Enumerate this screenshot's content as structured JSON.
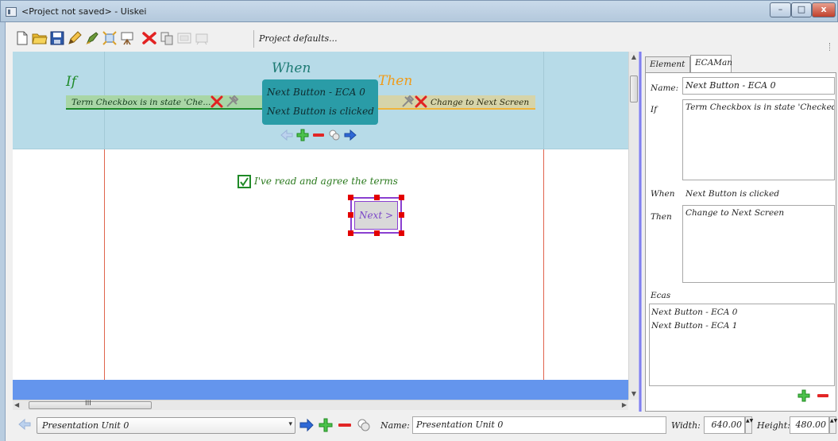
{
  "window": {
    "title": "<Project not saved> - Uiskei",
    "minimize_glyph": "–",
    "maximize_glyph": "□",
    "close_glyph": "x"
  },
  "toolbar": {
    "icons": [
      "new-file-icon",
      "open-folder-icon",
      "save-icon",
      "pencil-icon",
      "edit-brush-icon",
      "resize-icon",
      "easel-icon",
      "delete-icon",
      "copy-icon",
      "screen-capture-icon",
      "presentation-icon"
    ],
    "project_defaults_label": "Project defaults..."
  },
  "eca": {
    "if_label": "If",
    "when_label": "When",
    "then_label": "Then",
    "if_condition": "Term Checkbox is in state 'Che...",
    "when_name": "Next Button - ECA 0",
    "when_event": "Next Button is clicked",
    "then_action": "Change to Next Screen"
  },
  "canvas": {
    "checkbox_label": "I've read and agree the terms",
    "checkbox_checked": true,
    "next_button_label": "Next >"
  },
  "scrollbars": {
    "up": "▲",
    "down": "▼",
    "left": "◀",
    "right": "▶",
    "grip": "III"
  },
  "right_panel": {
    "tabs": [
      "Element",
      "ECAMan"
    ],
    "active_tab": "ECAMan",
    "name_label": "Name:",
    "name_value": "Next Button - ECA 0",
    "if_label": "If",
    "if_value": "Term Checkbox is in state 'Checked'",
    "when_label": "When",
    "when_value": "Next Button is clicked",
    "then_label": "Then",
    "then_value": "Change to Next Screen",
    "ecas_label": "Ecas",
    "ecas": [
      "Next Button - ECA 0",
      "Next Button - ECA 1"
    ]
  },
  "bottom_bar": {
    "unit_select_value": "Presentation Unit 0",
    "select_arrow": "▾",
    "name_label": "Name:",
    "name_value": "Presentation Unit 0",
    "width_label": "Width:",
    "width_value": "640.00",
    "height_label": "Height:",
    "height_value": "480.00",
    "spin_glyph": "▲▼"
  },
  "colors": {
    "if_green": "#1e8a29",
    "when_teal": "#2a9ca7",
    "then_orange": "#f09b18",
    "selection_purple": "#8a3fd0",
    "handle_red": "#e30000",
    "band_blue": "#6495ed"
  }
}
